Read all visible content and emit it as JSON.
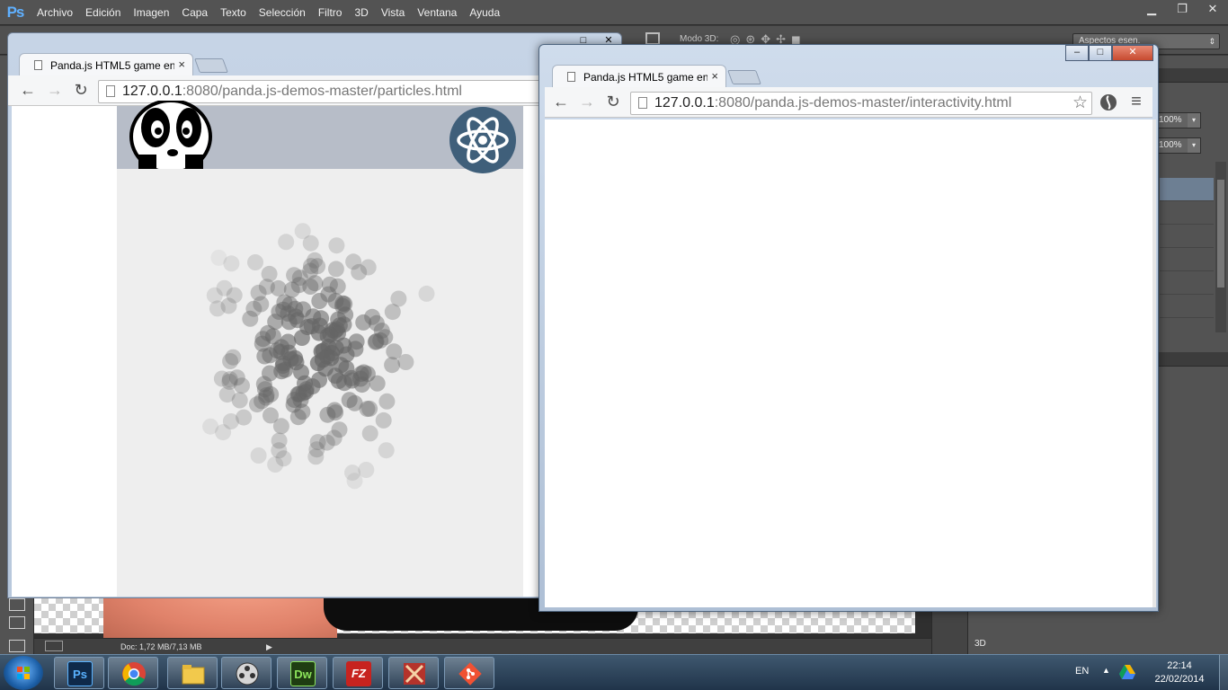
{
  "photoshop": {
    "logo": "Ps",
    "menu": [
      "Archivo",
      "Edición",
      "Imagen",
      "Capa",
      "Texto",
      "Selección",
      "Filtro",
      "3D",
      "Vista",
      "Ventana",
      "Ayuda"
    ],
    "options_bar": {
      "mode_3d_label": "Modo 3D:",
      "workspace": "Aspectos esen."
    },
    "panels": {
      "zoom_values": [
        "100%",
        "100%"
      ],
      "tab_3d": "3D"
    },
    "status": {
      "doc_info": "Doc: 1,72 MB/7,13 MB"
    }
  },
  "browser1": {
    "tab": {
      "title": "Panda.js HTML5 game en",
      "close": "×"
    },
    "url": {
      "host": "127.0.0.1",
      "rest": ":8080/panda.js-demos-master/particles.html"
    },
    "nav": {
      "back": "←",
      "forward": "→",
      "reload": "↻"
    }
  },
  "browser2": {
    "tab": {
      "title": "Panda.js HTML5 game en",
      "close": "×"
    },
    "url": {
      "host": "127.0.0.1",
      "rest": ":8080/panda.js-demos-master/interactivity.html"
    },
    "nav": {
      "back": "←",
      "forward": "→",
      "reload": "↻",
      "star": "☆",
      "menu": "≡"
    },
    "window_controls": {
      "minimize": "–",
      "maximize": "□",
      "close": "✕"
    }
  },
  "taskbar": {
    "apps": [
      {
        "label": "Ps",
        "name": "photoshop",
        "color": "#0f2a4a",
        "fg": "#59b2ff"
      },
      {
        "label": "",
        "name": "chrome",
        "color": "#ffffff",
        "fg": "#000000"
      },
      {
        "label": "",
        "name": "explorer",
        "color": "#f2c94c",
        "fg": "#000000"
      },
      {
        "label": "",
        "name": "media",
        "color": "#cfcfcf",
        "fg": "#000000"
      },
      {
        "label": "Dw",
        "name": "dreamweaver",
        "color": "#1f3d12",
        "fg": "#8be35a"
      },
      {
        "label": "FZ",
        "name": "filezilla",
        "color": "#c7231f",
        "fg": "#ffffff"
      },
      {
        "label": "",
        "name": "app-red",
        "color": "#b5332b",
        "fg": "#ffffff"
      },
      {
        "label": "",
        "name": "git",
        "color": "#f05133",
        "fg": "#ffffff"
      }
    ],
    "tray": {
      "language": "EN",
      "time": "22:14",
      "date": "22/02/2014"
    }
  }
}
